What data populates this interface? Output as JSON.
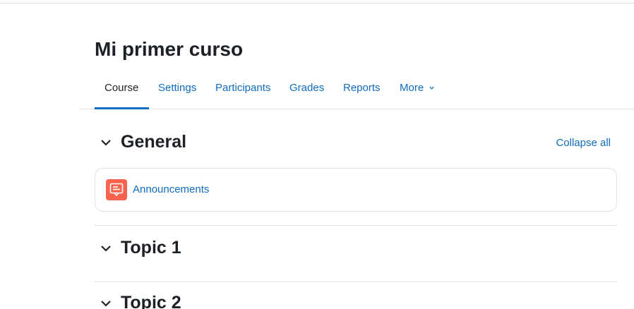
{
  "page": {
    "title": "Mi primer curso"
  },
  "nav": {
    "tabs": [
      {
        "label": "Course",
        "active": true
      },
      {
        "label": "Settings"
      },
      {
        "label": "Participants"
      },
      {
        "label": "Grades"
      },
      {
        "label": "Reports"
      },
      {
        "label": "More"
      }
    ],
    "more_icon": "chevron-down-icon"
  },
  "course": {
    "collapse_all_label": "Collapse all",
    "sections": [
      {
        "title": "General",
        "expanded": true,
        "activities": [
          {
            "name": "Announcements",
            "icon": "forum-icon",
            "icon_color": "#f7634d"
          }
        ]
      },
      {
        "title": "Topic 1",
        "expanded": true
      },
      {
        "title": "Topic 2",
        "expanded": true
      }
    ]
  },
  "colors": {
    "link": "#0f6cbf",
    "text": "#1d2125",
    "border": "#dee2e6"
  }
}
